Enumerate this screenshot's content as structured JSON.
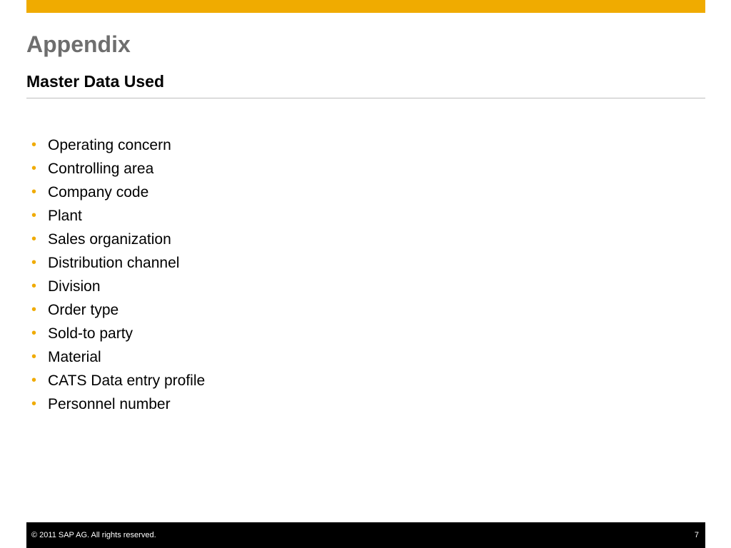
{
  "colors": {
    "accent": "#F0AB00",
    "title": "#6E6E6E",
    "subtitle": "#000000",
    "body_text": "#000000",
    "divider": "#BDBDBD",
    "footer_bg": "#000000",
    "footer_text": "#FFFFFF"
  },
  "slide": {
    "title": "Appendix",
    "subtitle": "Master Data Used",
    "bullets": [
      "Operating concern",
      "Controlling area",
      "Company code",
      "Plant",
      "Sales organization",
      "Distribution channel",
      "Division",
      "Order type",
      "Sold-to party",
      "Material",
      "CATS Data entry profile",
      "Personnel number"
    ]
  },
  "footer": {
    "copyright": "©  2011 SAP AG. All rights reserved.",
    "page_number": "7"
  }
}
